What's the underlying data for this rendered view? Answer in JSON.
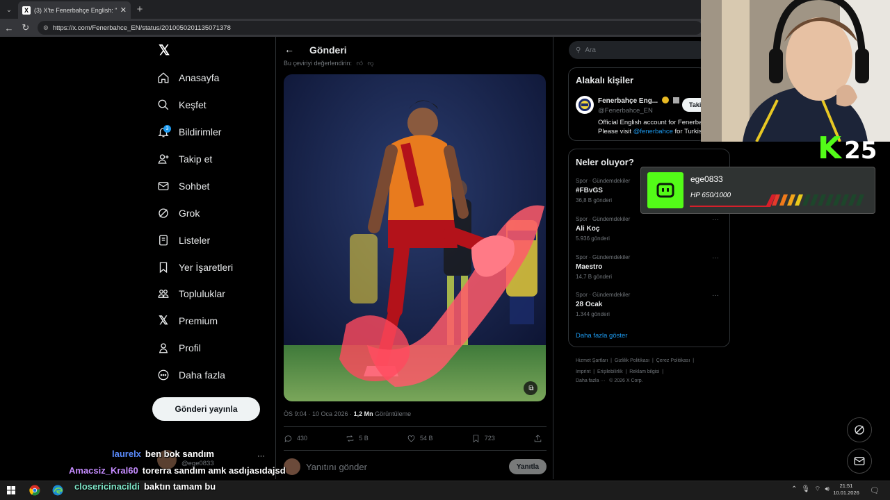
{
  "browser": {
    "tab_title": "(3) X'te Fenerbahçe English: \"Ne...",
    "url": "https://x.com/Fenerbahce_EN/status/2010050201135071378"
  },
  "nav": {
    "items": [
      {
        "label": "Anasayfa",
        "icon": "home-icon"
      },
      {
        "label": "Keşfet",
        "icon": "search-icon"
      },
      {
        "label": "Bildirimler",
        "icon": "bell-icon",
        "badge": "3"
      },
      {
        "label": "Takip et",
        "icon": "person-add-icon"
      },
      {
        "label": "Sohbet",
        "icon": "mail-icon"
      },
      {
        "label": "Grok",
        "icon": "grok-icon"
      },
      {
        "label": "Listeler",
        "icon": "list-icon"
      },
      {
        "label": "Yer İşaretleri",
        "icon": "bookmark-icon"
      },
      {
        "label": "Topluluklar",
        "icon": "communities-icon"
      },
      {
        "label": "Premium",
        "icon": "x-icon"
      },
      {
        "label": "Profil",
        "icon": "person-icon"
      },
      {
        "label": "Daha fazla",
        "icon": "more-circle-icon"
      }
    ],
    "post_button": "Gönderi yayınla",
    "account_handle": "@ege0833"
  },
  "post": {
    "header_title": "Gönderi",
    "rate_translation": "Bu çeviriyi değerlendirin:",
    "timestamp": "ÖS 9:04 · 10 Oca 2026 ·",
    "views_count": "1,2 Mn",
    "views_label": "Görüntüleme",
    "replies": "430",
    "reposts": "5 B",
    "likes": "54 B",
    "bookmarks": "723",
    "reply_placeholder": "Yanıtını gönder",
    "reply_button": "Yanıtla"
  },
  "right": {
    "search_placeholder": "Ara",
    "related_title": "Alakalı kişiler",
    "related": {
      "name": "Fenerbahçe Eng...",
      "handle": "@Fenerbahce_EN",
      "bio_line1": "Official English account for Fenerbahçe",
      "bio_line2_prefix": "Please visit ",
      "bio_line2_link": "@fenerbahce",
      "bio_line2_suffix": " for Turkish",
      "follow": "Takip et"
    },
    "trends_title": "Neler oluyor?",
    "trends": [
      {
        "category": "Spor · Gündemdekiler",
        "name": "#FBvGS",
        "count": "36,8 B gönderi"
      },
      {
        "category": "Spor · Gündemdekiler",
        "name": "Ali Koç",
        "count": "5.936 gönderi"
      },
      {
        "category": "Spor · Gündemdekiler",
        "name": "Maestro",
        "count": "14,7 B gönderi"
      },
      {
        "category": "Spor · Gündemdekiler",
        "name": "28 Ocak",
        "count": "1.344 gönderi"
      }
    ],
    "show_more": "Daha fazla göster",
    "footer": {
      "line1": [
        "Hizmet Şartları",
        "Gizlilik Politikası",
        "Çerez Politikası"
      ],
      "line2": [
        "Imprint",
        "Erişilebilirlik",
        "Reklam bilgisi"
      ],
      "line3": [
        "Daha fazla ···",
        "© 2026 X Corp."
      ]
    }
  },
  "stream": {
    "kick_letter": "K",
    "kick_number": "25",
    "hp_name": "ege0833",
    "hp_value": "HP 650/1000",
    "hp_fraction": 0.65,
    "chat": [
      {
        "user": "laurelx",
        "color": "#5b8cff",
        "text": "ben bok sandım"
      },
      {
        "user": "Amacsiz_Kral60",
        "color": "#c58cff",
        "text": "torerra sandım amk asdıjasıdajsd"
      },
      {
        "user": "closericinacildi",
        "color": "#7fe6c8",
        "text": "baktın tamam bu"
      }
    ]
  },
  "taskbar": {
    "time": "21:51",
    "date": "10.01.2026"
  }
}
